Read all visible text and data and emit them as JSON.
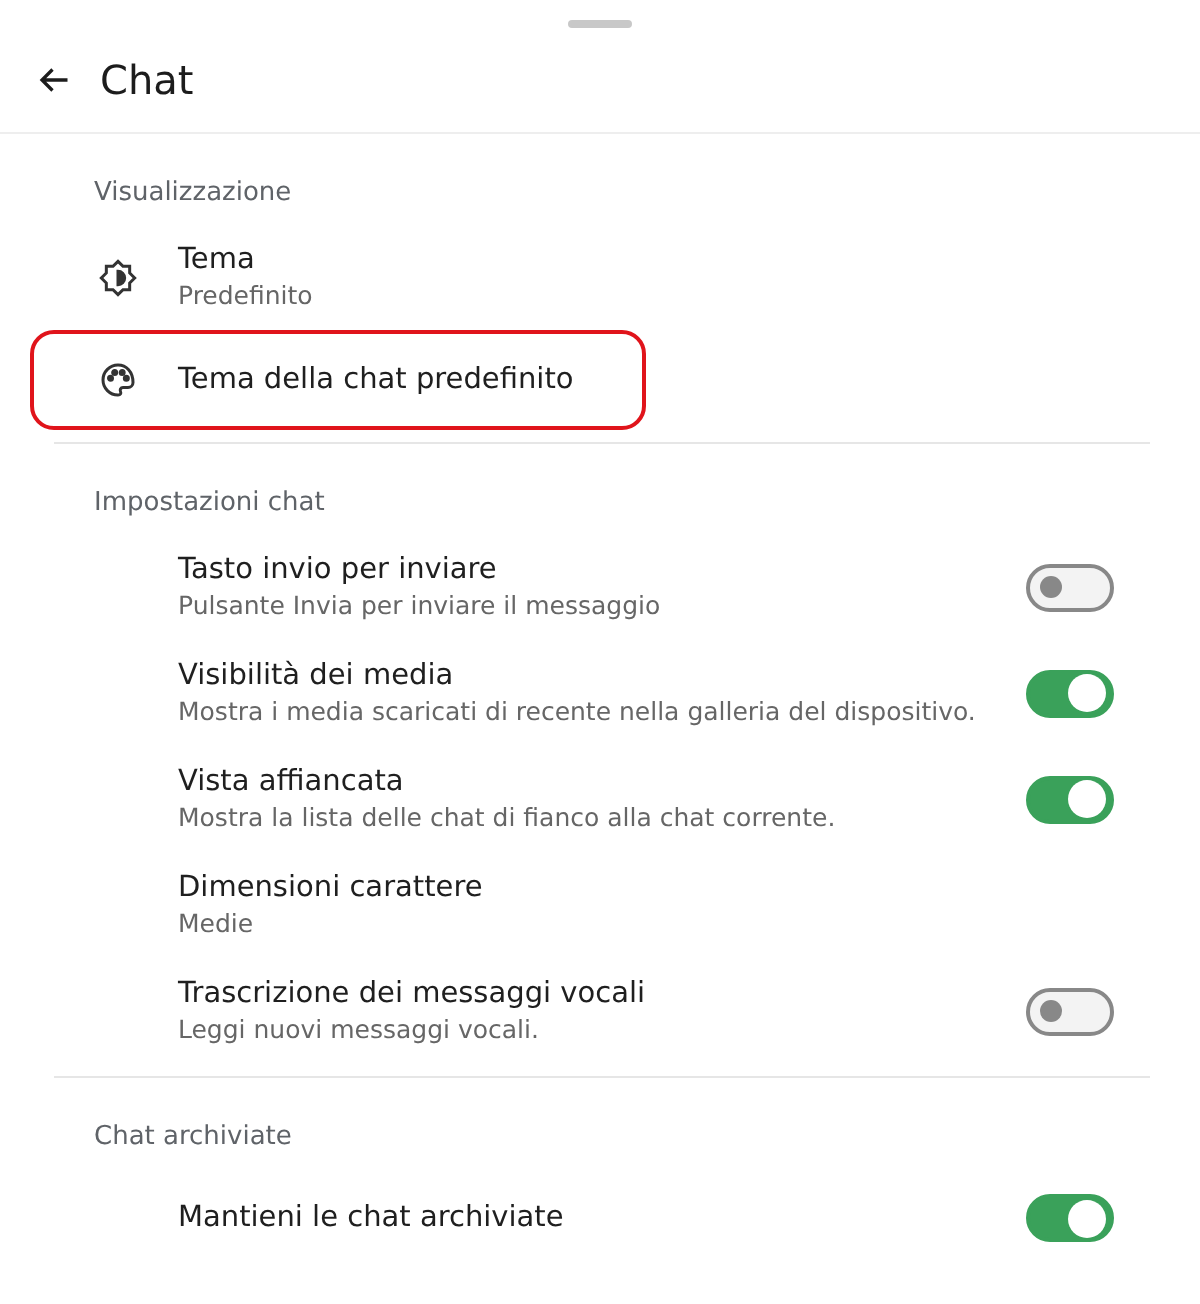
{
  "header": {
    "title": "Chat"
  },
  "sections": [
    {
      "title": "Visualizzazione",
      "items": [
        {
          "kind": "theme",
          "title": "Tema",
          "subtitle": "Predefinito",
          "highlighted": false
        },
        {
          "kind": "palette",
          "title": "Tema della chat predefinito",
          "highlighted": true
        }
      ]
    },
    {
      "title": "Impostazioni chat",
      "items": [
        {
          "kind": "toggle",
          "title": "Tasto invio per inviare",
          "subtitle": "Pulsante Invia per inviare il messaggio",
          "on": false
        },
        {
          "kind": "toggle",
          "title": "Visibilità dei media",
          "subtitle": "Mostra i media scaricati di recente nella galleria del dispositivo.",
          "on": true
        },
        {
          "kind": "toggle",
          "title": "Vista affiancata",
          "subtitle": "Mostra la lista delle chat di fianco alla chat corrente.",
          "on": true
        },
        {
          "kind": "plain",
          "title": "Dimensioni carattere",
          "subtitle": "Medie"
        },
        {
          "kind": "toggle",
          "title": "Trascrizione dei messaggi vocali",
          "subtitle": "Leggi nuovi messaggi vocali.",
          "on": false
        }
      ]
    },
    {
      "title": "Chat archiviate",
      "items": [
        {
          "kind": "toggle",
          "title": "Mantieni le chat archiviate",
          "on": true
        }
      ]
    }
  ]
}
